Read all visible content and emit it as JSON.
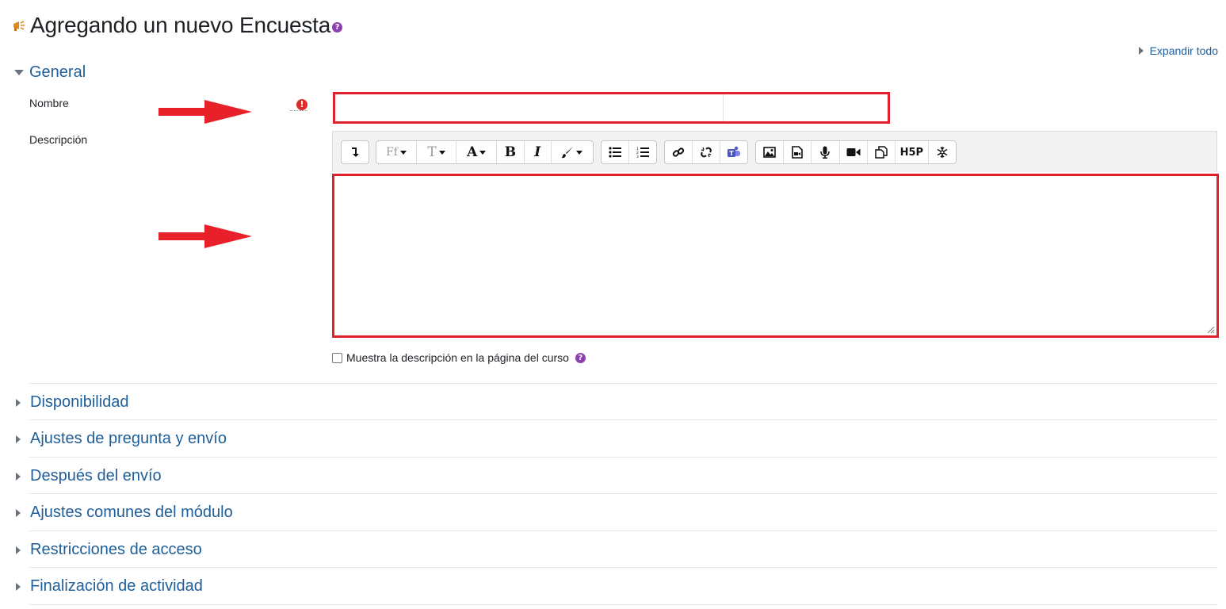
{
  "page": {
    "title": "Agregando un nuevo Encuesta",
    "expand_all": "Expandir todo"
  },
  "general": {
    "header": "General",
    "name_label": "Nombre",
    "name_value": "",
    "description_label": "Descripción",
    "description_value": "",
    "show_description_label": "Muestra la descripción en la página del curso",
    "show_description_checked": false
  },
  "toolbar": {
    "font_family_label": "Ff",
    "font_size_label": "T",
    "font_color_label": "A",
    "bold_label": "B",
    "italic_label": "I",
    "h5p_label": "H5P"
  },
  "sections": [
    {
      "label": "Disponibilidad"
    },
    {
      "label": "Ajustes de pregunta y envío"
    },
    {
      "label": "Después del envío"
    },
    {
      "label": "Ajustes comunes del módulo"
    },
    {
      "label": "Restricciones de acceso"
    },
    {
      "label": "Finalización de actividad"
    }
  ],
  "colors": {
    "link": "#1f5e99",
    "highlight_border": "#e0202a",
    "help_icon": "#8c3fb0",
    "required_icon": "#e12a2a",
    "arrow": "#e8202a"
  }
}
